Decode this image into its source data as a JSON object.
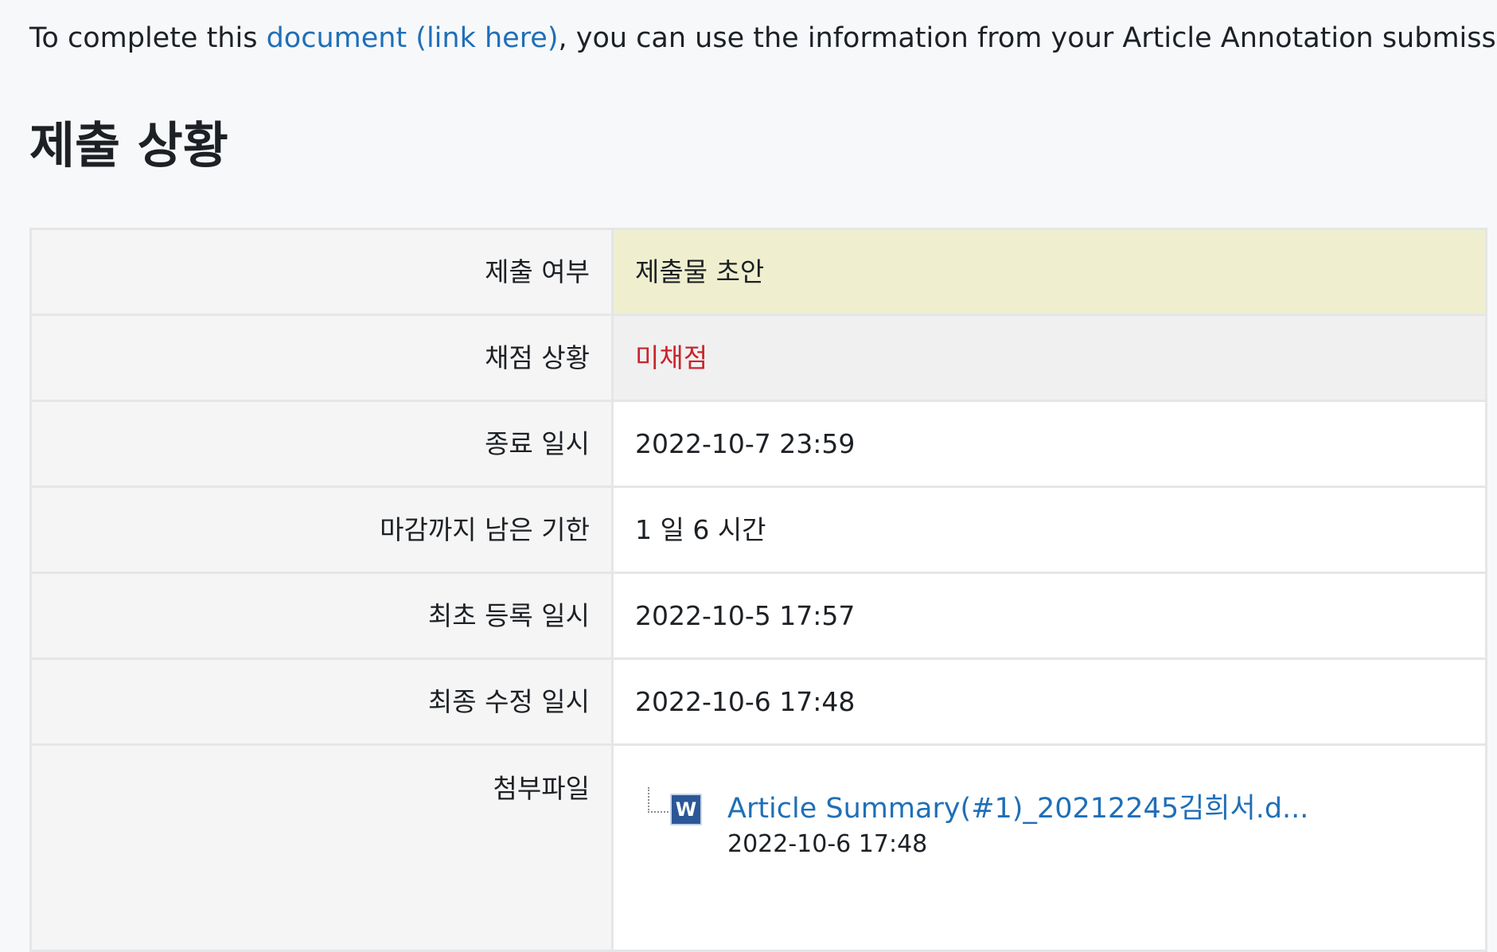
{
  "intro": {
    "text_before": "To complete this ",
    "link_text": "document (link here)",
    "text_after": ", you can use the information from your Article Annotation submission."
  },
  "page_title": "제출 상황",
  "status_rows": [
    {
      "label": "제출 여부",
      "value": "제출물 초안"
    },
    {
      "label": "채점 상황",
      "value": "미채점"
    },
    {
      "label": "종료 일시",
      "value": "2022-10-7 23:59"
    },
    {
      "label": "마감까지 남은 기한",
      "value": "1 일 6 시간"
    },
    {
      "label": "최초 등록 일시",
      "value": "2022-10-5 17:57"
    },
    {
      "label": "최종 수정 일시",
      "value": "2022-10-6 17:48"
    }
  ],
  "files": {
    "label": "첨부파일",
    "items": [
      {
        "icon": "word-document-icon",
        "icon_letter": "W",
        "name": "Article Summary(#1)_20212245김희서.d...",
        "date": "2022-10-6 17:48"
      }
    ]
  },
  "colors": {
    "link": "#1f6fb8",
    "submitted_bg": "#efefd0",
    "grading_bg": "#f0f0f0",
    "not_graded_text": "#c9252c"
  }
}
